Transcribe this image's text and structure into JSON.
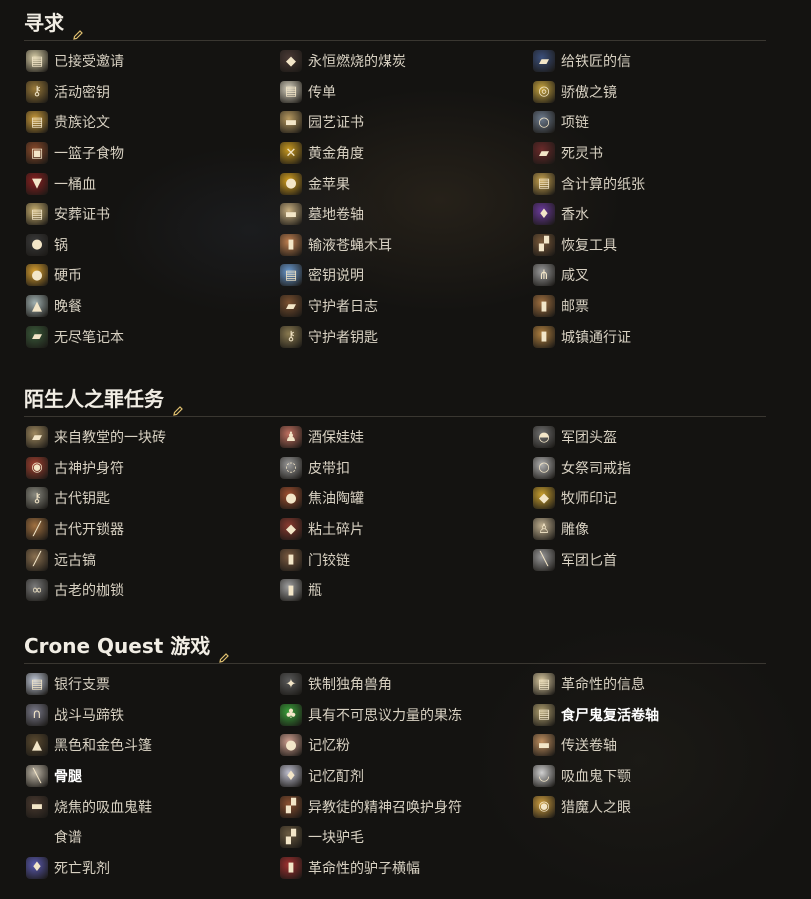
{
  "sections": [
    {
      "title": "寻求",
      "items": [
        {
          "label": "已接受邀请",
          "icon": "scroll-icon",
          "color": "#d9cfa8",
          "glyph": "▤"
        },
        {
          "label": "永恒燃烧的煤炭",
          "icon": "coal-icon",
          "color": "#4a3a35",
          "glyph": "◆"
        },
        {
          "label": "给铁匠的信",
          "icon": "book-icon",
          "color": "#3b4f7a",
          "glyph": "▰"
        },
        {
          "label": "活动密钥",
          "icon": "key-icon",
          "color": "#9a7a3a",
          "glyph": "⚷"
        },
        {
          "label": "传单",
          "icon": "flyer-icon",
          "color": "#d9d3c0",
          "glyph": "▤"
        },
        {
          "label": "骄傲之镜",
          "icon": "mirror-icon",
          "color": "#c9a640",
          "glyph": "◎"
        },
        {
          "label": "贵族论文",
          "icon": "document-icon",
          "color": "#c99a3a",
          "glyph": "▤"
        },
        {
          "label": "园艺证书",
          "icon": "certificate-icon",
          "color": "#b89a60",
          "glyph": "▬"
        },
        {
          "label": "项链",
          "icon": "necklace-icon",
          "color": "#6c7a8c",
          "glyph": "○"
        },
        {
          "label": "一篮子食物",
          "icon": "basket-icon",
          "color": "#8a4a2a",
          "glyph": "▣"
        },
        {
          "label": "黄金角度",
          "icon": "golden-angle-icon",
          "color": "#c99a20",
          "glyph": "✕"
        },
        {
          "label": "死灵书",
          "icon": "necronomicon-icon",
          "color": "#6a2a2a",
          "glyph": "▰"
        },
        {
          "label": "一桶血",
          "icon": "blood-bucket-icon",
          "color": "#8a2020",
          "glyph": "▼"
        },
        {
          "label": "金苹果",
          "icon": "golden-apple-icon",
          "color": "#d4a020",
          "glyph": "●"
        },
        {
          "label": "含计算的纸张",
          "icon": "paper-icon",
          "color": "#c9a450",
          "glyph": "▤"
        },
        {
          "label": "安葬证书",
          "icon": "burial-certificate-icon",
          "color": "#c9b070",
          "glyph": "▤"
        },
        {
          "label": "墓地卷轴",
          "icon": "scroll-roll-icon",
          "color": "#c9b080",
          "glyph": "▬"
        },
        {
          "label": "香水",
          "icon": "perfume-icon",
          "color": "#6a3a9a",
          "glyph": "♦"
        },
        {
          "label": "锅",
          "icon": "pot-icon",
          "color": "#3a3a3a",
          "glyph": "●"
        },
        {
          "label": "输液苍蝇木耳",
          "icon": "jar-icon",
          "color": "#c08050",
          "glyph": "▮"
        },
        {
          "label": "恢复工具",
          "icon": "tools-icon",
          "color": "#7a5a3a",
          "glyph": "▞"
        },
        {
          "label": "硬币",
          "icon": "coins-icon",
          "color": "#d9a030",
          "glyph": "●"
        },
        {
          "label": "密钥说明",
          "icon": "instructions-icon",
          "color": "#6a9ad0",
          "glyph": "▤"
        },
        {
          "label": "咸叉",
          "icon": "fork-icon",
          "color": "#9a9a9a",
          "glyph": "⋔"
        },
        {
          "label": "晚餐",
          "icon": "cloche-icon",
          "color": "#a0b0b0",
          "glyph": "▲"
        },
        {
          "label": "守护者日志",
          "icon": "log-book-icon",
          "color": "#7a5030",
          "glyph": "▰"
        },
        {
          "label": "邮票",
          "icon": "stamp-icon",
          "color": "#a07040",
          "glyph": "▮"
        },
        {
          "label": "无尽笔记本",
          "icon": "notebook-icon",
          "color": "#3a5a3a",
          "glyph": "▰"
        },
        {
          "label": "守护者钥匙",
          "icon": "keeper-key-icon",
          "color": "#8a7a50",
          "glyph": "⚷"
        },
        {
          "label": "城镇通行证",
          "icon": "pass-icon",
          "color": "#b08040",
          "glyph": "▮"
        }
      ]
    },
    {
      "title": "陌生人之罪任务",
      "items": [
        {
          "label": "来自教堂的一块砖",
          "icon": "brick-icon",
          "color": "#a08a60",
          "glyph": "▰"
        },
        {
          "label": "酒保娃娃",
          "icon": "doll-icon",
          "color": "#c07060",
          "glyph": "♟"
        },
        {
          "label": "军团头盔",
          "icon": "helmet-icon",
          "color": "#707070",
          "glyph": "◓"
        },
        {
          "label": "古神护身符",
          "icon": "amulet-icon",
          "color": "#a04030",
          "glyph": "◉"
        },
        {
          "label": "皮带扣",
          "icon": "buckle-icon",
          "color": "#9a9a9a",
          "glyph": "◌"
        },
        {
          "label": "女祭司戒指",
          "icon": "ring-icon",
          "color": "#b0b0b0",
          "glyph": "○"
        },
        {
          "label": "古代钥匙",
          "icon": "ancient-key-icon",
          "color": "#8a8a80",
          "glyph": "⚷"
        },
        {
          "label": "焦油陶罐",
          "icon": "tar-jar-icon",
          "color": "#a05030",
          "glyph": "●"
        },
        {
          "label": "牧师印记",
          "icon": "seal-icon",
          "color": "#c9a030",
          "glyph": "◆"
        },
        {
          "label": "古代开锁器",
          "icon": "lockpick-icon",
          "color": "#a07040",
          "glyph": "╱"
        },
        {
          "label": "粘土碎片",
          "icon": "clay-shard-icon",
          "color": "#8a3a30",
          "glyph": "◆"
        },
        {
          "label": "雕像",
          "icon": "statue-icon",
          "color": "#c0b090",
          "glyph": "♙"
        },
        {
          "label": "远古镐",
          "icon": "pickaxe-icon",
          "color": "#8a7050",
          "glyph": "╱"
        },
        {
          "label": "门铰链",
          "icon": "hinge-icon",
          "color": "#7a5a40",
          "glyph": "▮"
        },
        {
          "label": "军团匕首",
          "icon": "dagger-icon",
          "color": "#9a9a9a",
          "glyph": "╲"
        },
        {
          "label": "古老的枷锁",
          "icon": "shackles-icon",
          "color": "#7a7a7a",
          "glyph": "∞"
        },
        {
          "label": "瓶",
          "icon": "bottle-icon",
          "color": "#a0a0a0",
          "glyph": "▮"
        }
      ]
    },
    {
      "title": "Crone Quest 游戏",
      "items": [
        {
          "label": "银行支票",
          "icon": "check-icon",
          "color": "#c0c8d8",
          "glyph": "▤"
        },
        {
          "label": "铁制独角兽角",
          "icon": "unicorn-horn-icon",
          "color": "#5a5a5a",
          "glyph": "✦"
        },
        {
          "label": "革命性的信息",
          "icon": "message-icon",
          "color": "#d9c9a0",
          "glyph": "▤"
        },
        {
          "label": "战斗马蹄铁",
          "icon": "horseshoe-icon",
          "color": "#7a7a8a",
          "glyph": "∩"
        },
        {
          "label": "具有不可思议力量的果冻",
          "icon": "jelly-icon",
          "color": "#3aa03a",
          "glyph": "♣"
        },
        {
          "label": "食尸鬼复活卷轴",
          "icon": "ghoul-scroll-icon",
          "color": "#b0a070",
          "glyph": "▤",
          "bold": true
        },
        {
          "label": "黑色和金色斗篷",
          "icon": "cloak-icon",
          "color": "#5a4a30",
          "glyph": "▲"
        },
        {
          "label": "记忆粉",
          "icon": "powder-icon",
          "color": "#d0a090",
          "glyph": "●"
        },
        {
          "label": "传送卷轴",
          "icon": "teleport-scroll-icon",
          "color": "#c09060",
          "glyph": "▬"
        },
        {
          "label": "骨腿",
          "icon": "bone-leg-icon",
          "color": "#c0b8a8",
          "glyph": "╲",
          "bold": true
        },
        {
          "label": "记忆酊剂",
          "icon": "tincture-icon",
          "color": "#c0c0d0",
          "glyph": "♦"
        },
        {
          "label": "吸血鬼下颚",
          "icon": "jaw-icon",
          "color": "#d0d0d0",
          "glyph": "◡"
        },
        {
          "label": "烧焦的吸血鬼鞋",
          "icon": "shoe-icon",
          "color": "#4a3a30",
          "glyph": "▬"
        },
        {
          "label": "异教徒的精神召唤护身符",
          "icon": "talisman-icon",
          "color": "#8a5030",
          "glyph": "▞"
        },
        {
          "label": "猎魔人之眼",
          "icon": "eye-coin-icon",
          "color": "#d0a040",
          "glyph": "◉"
        },
        {
          "label": "食谱",
          "icon": "",
          "color": "",
          "glyph": ""
        },
        {
          "label": "一块驴毛",
          "icon": "fur-icon",
          "color": "#6a5a40",
          "glyph": "▞"
        },
        {
          "label": "",
          "icon": "",
          "color": "",
          "glyph": ""
        },
        {
          "label": "死亡乳剂",
          "icon": "potion-icon",
          "color": "#5a5ab0",
          "glyph": "♦"
        },
        {
          "label": "革命性的驴子横幅",
          "icon": "banner-icon",
          "color": "#a03030",
          "glyph": "▮"
        }
      ]
    }
  ]
}
